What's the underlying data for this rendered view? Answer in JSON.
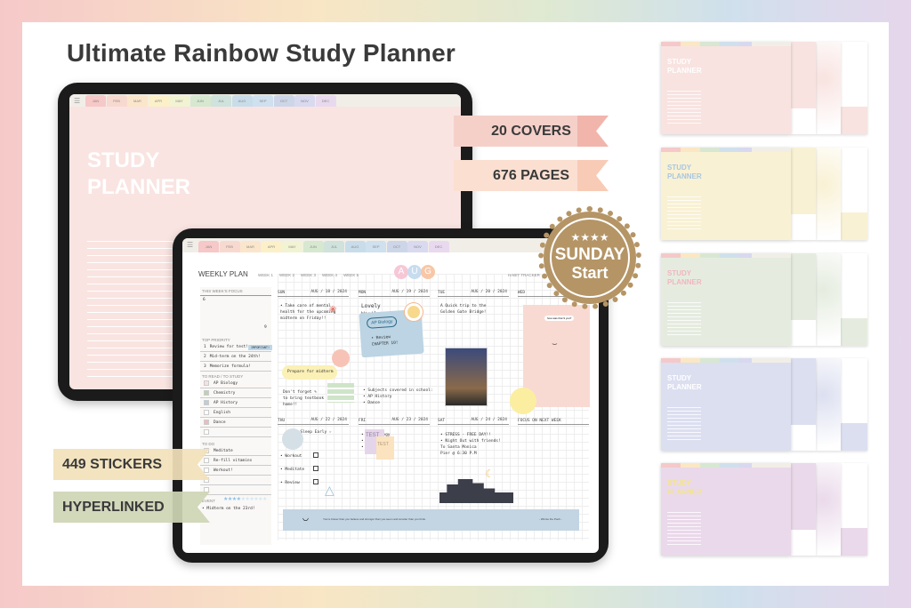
{
  "title": "Ultimate Rainbow Study Planner",
  "ribbons": {
    "covers": "20 COVERS",
    "pages": "676 PAGES",
    "stickers": "449 STICKERS",
    "hyperlinked": "HYPERLINKED"
  },
  "badge": {
    "stars": "★★★★",
    "line1": "SUNDAY",
    "line2": "Start",
    "color": "#b59566"
  },
  "months": [
    "JAN",
    "FEB",
    "MAR",
    "APR",
    "MAY",
    "JUN",
    "JUL",
    "AUG",
    "SEP",
    "OCT",
    "NOV",
    "DEC"
  ],
  "month_colors": [
    "#f6c8c8",
    "#f8d9cf",
    "#fbe6cc",
    "#fbf0c8",
    "#f2f3d2",
    "#d6e8d0",
    "#cfe2dc",
    "#c8dde9",
    "#cfe0ef",
    "#cdd6e8",
    "#d9d9ef",
    "#e9d9ee"
  ],
  "cover": {
    "title_line1": "STUDY",
    "title_line2": "PLANNER",
    "color": "#f9e4e1"
  },
  "weekly": {
    "heading": "WEEKLY PLAN",
    "weeks": [
      "WEEK 1",
      "WEEK 2",
      "WEEK 3",
      "WEEK 4",
      "WEEK 5"
    ],
    "month": [
      "A",
      "U",
      "G"
    ],
    "habit_tracker": "HABIT TRACKER",
    "focus_label": "THIS WEEK'S FOCUS",
    "focus_start": "6",
    "focus_end": "9",
    "priority_label": "TOP PRIORITY",
    "priorities": [
      {
        "n": "1",
        "text": "Review for test!",
        "tag": "IMPORTANT!"
      },
      {
        "n": "2",
        "text": "Mid-term on the 24th!"
      },
      {
        "n": "3",
        "text": "Memorize formula!"
      }
    ],
    "study_label": "TO READ / TO STUDY",
    "study": [
      {
        "text": "AP Biology",
        "color": "#f6e1e3"
      },
      {
        "text": "Chemistry",
        "color": "#b9d3b3"
      },
      {
        "text": "AP History",
        "color": "#b7cfe0"
      },
      {
        "text": "English",
        "color": "#ffffff"
      },
      {
        "text": "Dance",
        "color": "#f1b9bf"
      },
      {
        "text": "",
        "color": "#ffffff"
      }
    ],
    "todo_label": "TO DO",
    "todos": [
      "Meditate",
      "Re-fill vitamins",
      "Workout!",
      "",
      ""
    ],
    "event_label": "EVENT",
    "event_rating": 4,
    "event_rating_max": 10,
    "event_text": "• Midterm on the 23rd!",
    "days": [
      {
        "name": "SUN",
        "date": "AUG / 18 / 2024",
        "notes": [
          "• Take care of mental",
          "health for the upcoming",
          "midterm on Friday!!"
        ],
        "extra": [
          "Prepare for midterm"
        ]
      },
      {
        "name": "MON",
        "date": "AUG / 19 / 2024",
        "notes": [
          "Lovely",
          "Weather~"
        ],
        "extra": [
          "• Subjects covered in school:",
          "• AP History",
          "• Dance"
        ],
        "sticker": "AP Biology",
        "sticker_note": [
          "• Review",
          "CHAPTER 10!"
        ],
        "sticker_tab": "REVIEW"
      },
      {
        "name": "TUE",
        "date": "AUG / 20 / 2024",
        "notes": [
          "A Quick trip to the",
          "Golden Gate Bridge!"
        ]
      },
      {
        "name": "WED",
        "date": "AUG / 21",
        "speech": "how was that 9 you?"
      },
      {
        "name": "THU",
        "date": "AUG / 22 / 2024",
        "notes": [
          "☆ Sleep Early ☆"
        ],
        "checks": [
          "• Workout",
          "• Meditate",
          "• Review"
        ],
        "reminder": [
          "Don't forget ✎",
          "to bring textbook",
          "home!!"
        ]
      },
      {
        "name": "FRI",
        "date": "AUG / 23 / 2024",
        "notes": [
          "• AP Biology",
          "• Chemistry",
          "• AP History"
        ],
        "test": "TEST"
      },
      {
        "name": "SAT",
        "date": "AUG / 24 / 2024",
        "notes": [
          "• STRESS - FREE DAY!!",
          "• Night Out with friends!",
          "To Santa Monica",
          "Pier @ 6:30 P.M"
        ]
      }
    ],
    "next_week_label": "FOCUS ON NEXT WEEK",
    "quote": "You're braver than you believe and stronger than you seem and smarter than you think.",
    "quote_author": "- Winnie the Pooh -"
  },
  "thumbnails": [
    {
      "bg": "#f8e3e0",
      "title_color": "#ffffff",
      "line1": "STUDY",
      "line2": "PLANNER"
    },
    {
      "bg": "#f9f1d4",
      "title_color": "#a9c6e0",
      "line1": "STUDY",
      "line2": "PLANNER"
    },
    {
      "bg": "#e5ecdf",
      "title_color": "#f1b5c0",
      "line1": "STUDY",
      "line2": "PLANNER"
    },
    {
      "bg": "#dcdff0",
      "title_color": "#ffffff",
      "line1": "STUDY",
      "line2": "PLANNER"
    },
    {
      "bg": "#ead9ea",
      "title_color": "#f3e58b",
      "line1": "STUDY",
      "line2": "PLANNER"
    }
  ]
}
